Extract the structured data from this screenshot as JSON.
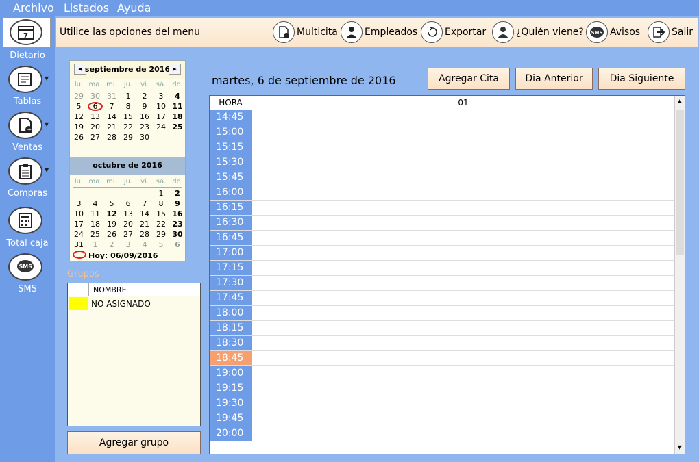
{
  "menu": [
    "Archivo",
    "Listados",
    "Ayuda"
  ],
  "sidebar": [
    {
      "label": "Dietario",
      "icon": "calendar-icon",
      "caret": false
    },
    {
      "label": "Tablas",
      "icon": "table-icon",
      "caret": true
    },
    {
      "label": "Ventas",
      "icon": "sales-icon",
      "caret": true
    },
    {
      "label": "Compras",
      "icon": "clipboard-icon",
      "caret": true
    },
    {
      "label": "Total caja",
      "icon": "calculator-icon",
      "caret": false
    },
    {
      "label": "SMS",
      "icon": "sms-icon",
      "caret": false
    }
  ],
  "toolbar": {
    "hint": "Utilice las opciones del menu",
    "buttons": [
      {
        "label": "Multicita",
        "icon": "multicita-icon"
      },
      {
        "label": "Empleados",
        "icon": "employees-icon"
      },
      {
        "label": "Exportar",
        "icon": "export-icon"
      },
      {
        "label": "¿Quién viene?",
        "icon": "person-icon"
      },
      {
        "label": "Avisos",
        "icon": "sms-icon"
      },
      {
        "label": "Salir",
        "icon": "exit-icon"
      }
    ]
  },
  "calendar": {
    "weekdays": [
      "lu.",
      "ma.",
      "mi.",
      "ju.",
      "vi.",
      "sá.",
      "do."
    ],
    "months": [
      {
        "title": "septiembre de 2016",
        "days": [
          [
            "29",
            "30",
            "31",
            "1",
            "2",
            "3",
            "4"
          ],
          [
            "5",
            "6",
            "7",
            "8",
            "9",
            "10",
            "11"
          ],
          [
            "12",
            "13",
            "14",
            "15",
            "16",
            "17",
            "18"
          ],
          [
            "19",
            "20",
            "21",
            "22",
            "23",
            "24",
            "25"
          ],
          [
            "26",
            "27",
            "28",
            "29",
            "30",
            "",
            ""
          ]
        ]
      },
      {
        "title": "octubre de 2016",
        "days": [
          [
            "",
            "",
            "",
            "",
            "",
            "1",
            "2"
          ],
          [
            "3",
            "4",
            "5",
            "6",
            "7",
            "8",
            "9"
          ],
          [
            "10",
            "11",
            "12",
            "13",
            "14",
            "15",
            "16"
          ],
          [
            "17",
            "18",
            "19",
            "20",
            "21",
            "22",
            "23"
          ],
          [
            "24",
            "25",
            "26",
            "27",
            "28",
            "29",
            "30"
          ],
          [
            "31",
            "1",
            "2",
            "3",
            "4",
            "5",
            "6"
          ]
        ]
      }
    ],
    "selected_day": "6",
    "today_label": "Hoy: 06/09/2016"
  },
  "groups": {
    "label": "Grupos",
    "column": "NOMBRE",
    "rows": [
      {
        "name": "NO ASIGNADO",
        "color": "#ffff00"
      }
    ],
    "add_button": "Agregar grupo"
  },
  "day_view": {
    "date_title": "martes, 6 de septiembre de 2016",
    "buttons": [
      "Agregar Cita",
      "Dia Anterior",
      "Dia Siguiente"
    ],
    "hora_header": "HORA",
    "column_header": "01",
    "times": [
      "14:45",
      "15:00",
      "15:15",
      "15:30",
      "15:45",
      "16:00",
      "16:15",
      "16:30",
      "16:45",
      "17:00",
      "17:15",
      "17:30",
      "17:45",
      "18:00",
      "18:15",
      "18:30",
      "18:45",
      "19:00",
      "19:15",
      "19:30",
      "19:45",
      "20:00"
    ],
    "highlight_time": "18:45"
  },
  "colors": {
    "accent": "#6e9ce6",
    "highlight": "#f5a070",
    "panel": "#fdfcea"
  }
}
